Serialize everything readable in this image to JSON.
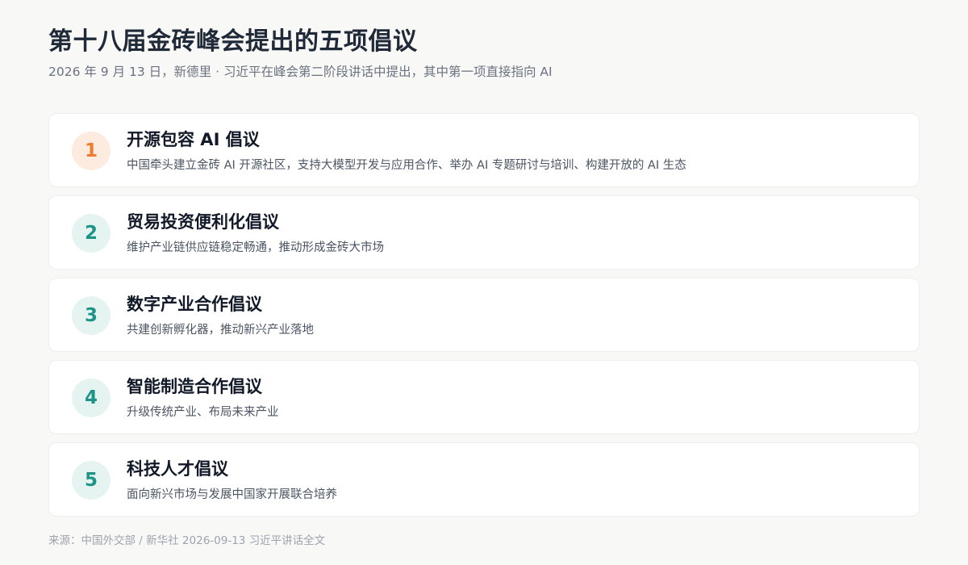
{
  "header": {
    "title": "第十八届金砖峰会提出的五项倡议",
    "subtitle": "2026 年 9 月 13 日，新德里 · 习近平在峰会第二阶段讲话中提出，其中第一项直接指向 AI"
  },
  "colors": {
    "highlight_badge_bg": "#fdebe0",
    "highlight_badge_text": "#ef7b2e",
    "badge_bg": "#e5f3f1",
    "badge_text": "#1e9488",
    "page_bg": "#f8f8f6",
    "card_bg": "#ffffff"
  },
  "initiatives": [
    {
      "number": "1",
      "title": "开源包容 AI 倡议",
      "description": "中国牵头建立金砖 AI 开源社区，支持大模型开发与应用合作、举办 AI 专题研讨与培训、构建开放的 AI 生态",
      "highlighted": true
    },
    {
      "number": "2",
      "title": "贸易投资便利化倡议",
      "description": "维护产业链供应链稳定畅通，推动形成金砖大市场",
      "highlighted": false
    },
    {
      "number": "3",
      "title": "数字产业合作倡议",
      "description": "共建创新孵化器，推动新兴产业落地",
      "highlighted": false
    },
    {
      "number": "4",
      "title": "智能制造合作倡议",
      "description": "升级传统产业、布局未来产业",
      "highlighted": false
    },
    {
      "number": "5",
      "title": "科技人才倡议",
      "description": "面向新兴市场与发展中国家开展联合培养",
      "highlighted": false
    }
  ],
  "footer": {
    "source": "来源：中国外交部 / 新华社 2026-09-13 习近平讲话全文"
  }
}
